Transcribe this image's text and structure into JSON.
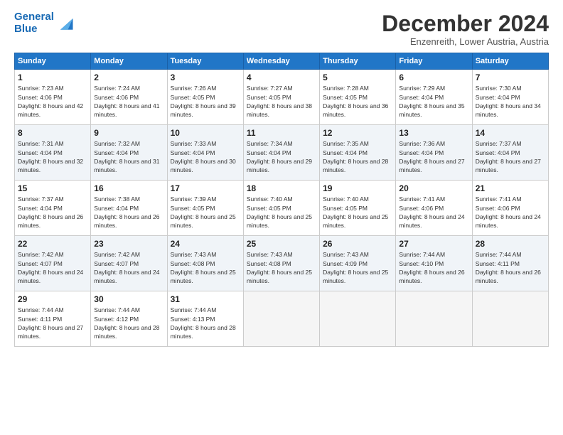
{
  "logo": {
    "line1": "General",
    "line2": "Blue"
  },
  "title": "December 2024",
  "subtitle": "Enzenreith, Lower Austria, Austria",
  "days_of_week": [
    "Sunday",
    "Monday",
    "Tuesday",
    "Wednesday",
    "Thursday",
    "Friday",
    "Saturday"
  ],
  "weeks": [
    [
      {
        "day": "1",
        "sunrise": "Sunrise: 7:23 AM",
        "sunset": "Sunset: 4:06 PM",
        "daylight": "Daylight: 8 hours and 42 minutes."
      },
      {
        "day": "2",
        "sunrise": "Sunrise: 7:24 AM",
        "sunset": "Sunset: 4:06 PM",
        "daylight": "Daylight: 8 hours and 41 minutes."
      },
      {
        "day": "3",
        "sunrise": "Sunrise: 7:26 AM",
        "sunset": "Sunset: 4:05 PM",
        "daylight": "Daylight: 8 hours and 39 minutes."
      },
      {
        "day": "4",
        "sunrise": "Sunrise: 7:27 AM",
        "sunset": "Sunset: 4:05 PM",
        "daylight": "Daylight: 8 hours and 38 minutes."
      },
      {
        "day": "5",
        "sunrise": "Sunrise: 7:28 AM",
        "sunset": "Sunset: 4:05 PM",
        "daylight": "Daylight: 8 hours and 36 minutes."
      },
      {
        "day": "6",
        "sunrise": "Sunrise: 7:29 AM",
        "sunset": "Sunset: 4:04 PM",
        "daylight": "Daylight: 8 hours and 35 minutes."
      },
      {
        "day": "7",
        "sunrise": "Sunrise: 7:30 AM",
        "sunset": "Sunset: 4:04 PM",
        "daylight": "Daylight: 8 hours and 34 minutes."
      }
    ],
    [
      {
        "day": "8",
        "sunrise": "Sunrise: 7:31 AM",
        "sunset": "Sunset: 4:04 PM",
        "daylight": "Daylight: 8 hours and 32 minutes."
      },
      {
        "day": "9",
        "sunrise": "Sunrise: 7:32 AM",
        "sunset": "Sunset: 4:04 PM",
        "daylight": "Daylight: 8 hours and 31 minutes."
      },
      {
        "day": "10",
        "sunrise": "Sunrise: 7:33 AM",
        "sunset": "Sunset: 4:04 PM",
        "daylight": "Daylight: 8 hours and 30 minutes."
      },
      {
        "day": "11",
        "sunrise": "Sunrise: 7:34 AM",
        "sunset": "Sunset: 4:04 PM",
        "daylight": "Daylight: 8 hours and 29 minutes."
      },
      {
        "day": "12",
        "sunrise": "Sunrise: 7:35 AM",
        "sunset": "Sunset: 4:04 PM",
        "daylight": "Daylight: 8 hours and 28 minutes."
      },
      {
        "day": "13",
        "sunrise": "Sunrise: 7:36 AM",
        "sunset": "Sunset: 4:04 PM",
        "daylight": "Daylight: 8 hours and 27 minutes."
      },
      {
        "day": "14",
        "sunrise": "Sunrise: 7:37 AM",
        "sunset": "Sunset: 4:04 PM",
        "daylight": "Daylight: 8 hours and 27 minutes."
      }
    ],
    [
      {
        "day": "15",
        "sunrise": "Sunrise: 7:37 AM",
        "sunset": "Sunset: 4:04 PM",
        "daylight": "Daylight: 8 hours and 26 minutes."
      },
      {
        "day": "16",
        "sunrise": "Sunrise: 7:38 AM",
        "sunset": "Sunset: 4:04 PM",
        "daylight": "Daylight: 8 hours and 26 minutes."
      },
      {
        "day": "17",
        "sunrise": "Sunrise: 7:39 AM",
        "sunset": "Sunset: 4:05 PM",
        "daylight": "Daylight: 8 hours and 25 minutes."
      },
      {
        "day": "18",
        "sunrise": "Sunrise: 7:40 AM",
        "sunset": "Sunset: 4:05 PM",
        "daylight": "Daylight: 8 hours and 25 minutes."
      },
      {
        "day": "19",
        "sunrise": "Sunrise: 7:40 AM",
        "sunset": "Sunset: 4:05 PM",
        "daylight": "Daylight: 8 hours and 25 minutes."
      },
      {
        "day": "20",
        "sunrise": "Sunrise: 7:41 AM",
        "sunset": "Sunset: 4:06 PM",
        "daylight": "Daylight: 8 hours and 24 minutes."
      },
      {
        "day": "21",
        "sunrise": "Sunrise: 7:41 AM",
        "sunset": "Sunset: 4:06 PM",
        "daylight": "Daylight: 8 hours and 24 minutes."
      }
    ],
    [
      {
        "day": "22",
        "sunrise": "Sunrise: 7:42 AM",
        "sunset": "Sunset: 4:07 PM",
        "daylight": "Daylight: 8 hours and 24 minutes."
      },
      {
        "day": "23",
        "sunrise": "Sunrise: 7:42 AM",
        "sunset": "Sunset: 4:07 PM",
        "daylight": "Daylight: 8 hours and 24 minutes."
      },
      {
        "day": "24",
        "sunrise": "Sunrise: 7:43 AM",
        "sunset": "Sunset: 4:08 PM",
        "daylight": "Daylight: 8 hours and 25 minutes."
      },
      {
        "day": "25",
        "sunrise": "Sunrise: 7:43 AM",
        "sunset": "Sunset: 4:08 PM",
        "daylight": "Daylight: 8 hours and 25 minutes."
      },
      {
        "day": "26",
        "sunrise": "Sunrise: 7:43 AM",
        "sunset": "Sunset: 4:09 PM",
        "daylight": "Daylight: 8 hours and 25 minutes."
      },
      {
        "day": "27",
        "sunrise": "Sunrise: 7:44 AM",
        "sunset": "Sunset: 4:10 PM",
        "daylight": "Daylight: 8 hours and 26 minutes."
      },
      {
        "day": "28",
        "sunrise": "Sunrise: 7:44 AM",
        "sunset": "Sunset: 4:11 PM",
        "daylight": "Daylight: 8 hours and 26 minutes."
      }
    ],
    [
      {
        "day": "29",
        "sunrise": "Sunrise: 7:44 AM",
        "sunset": "Sunset: 4:11 PM",
        "daylight": "Daylight: 8 hours and 27 minutes."
      },
      {
        "day": "30",
        "sunrise": "Sunrise: 7:44 AM",
        "sunset": "Sunset: 4:12 PM",
        "daylight": "Daylight: 8 hours and 28 minutes."
      },
      {
        "day": "31",
        "sunrise": "Sunrise: 7:44 AM",
        "sunset": "Sunset: 4:13 PM",
        "daylight": "Daylight: 8 hours and 28 minutes."
      },
      null,
      null,
      null,
      null
    ]
  ]
}
